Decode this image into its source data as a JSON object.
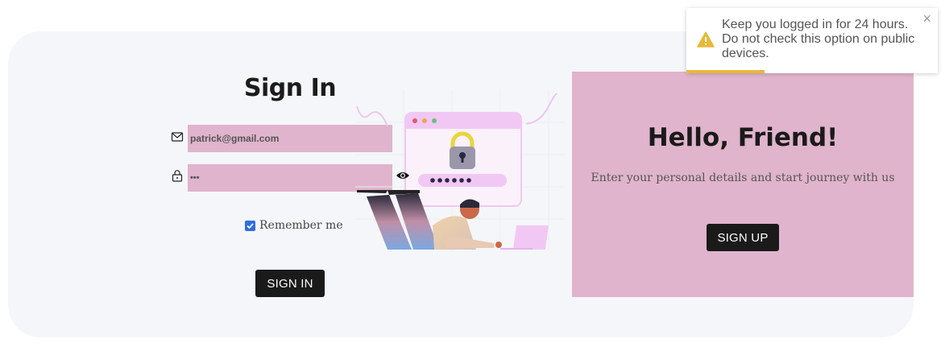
{
  "signin": {
    "title": "Sign In",
    "email_value": "patrick@gmail.com",
    "password_value": "•••",
    "remember_label": "Remember me",
    "remember_checked": true,
    "button_label": "SIGN IN"
  },
  "signup_panel": {
    "title": "Hello, Friend!",
    "subtitle": "Enter your personal details and start journey with us",
    "button_label": "SIGN UP",
    "background": "#e0b4cc"
  },
  "toast": {
    "message": "Keep you logged in for 24 hours. Do not check this option on public devices.",
    "icon": "warning-icon",
    "close_icon": "close-icon",
    "progress": 0.31,
    "accent": "#e8b83a"
  },
  "icons": {
    "email": "mail-icon",
    "password": "lock-icon",
    "toggle_password": "eye-icon"
  },
  "colors": {
    "field_bg": "#e0b4cc",
    "button_bg": "#1a1a1a",
    "checkbox": "#2f6fdc"
  }
}
